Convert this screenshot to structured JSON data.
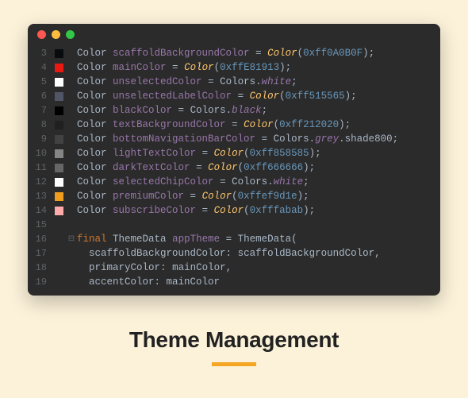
{
  "caption": "Theme Management",
  "lines": [
    {
      "num": 3,
      "swatch": "#0A0B0F",
      "t": "Color ",
      "v": "scaffoldBackgroundColor",
      "rhs_type": "call",
      "call": "Color",
      "arg": "0xff0A0B0F"
    },
    {
      "num": 4,
      "swatch": "#E81913",
      "t": "Color ",
      "v": "mainColor",
      "rhs_type": "call",
      "call": "Color",
      "arg": "0xffE81913"
    },
    {
      "num": 5,
      "swatch": "#ffffff",
      "t": "Color ",
      "v": "unselectedColor",
      "rhs_type": "prop",
      "obj": "Colors",
      "prop": "white"
    },
    {
      "num": 6,
      "swatch": "#515565",
      "t": "Color ",
      "v": "unselectedLabelColor",
      "rhs_type": "call",
      "call": "Color",
      "arg": "0xff515565"
    },
    {
      "num": 7,
      "swatch": "#000000",
      "t": "Color ",
      "v": "blackColor",
      "rhs_type": "prop",
      "obj": "Colors",
      "prop": "black"
    },
    {
      "num": 8,
      "swatch": "#212020",
      "t": "Color ",
      "v": "textBackgroundColor",
      "rhs_type": "call",
      "call": "Color",
      "arg": "0xff212020"
    },
    {
      "num": 9,
      "swatch": "#424242",
      "t": "Color ",
      "v": "bottomNavigationBarColor",
      "rhs_type": "prop2",
      "obj": "Colors",
      "prop": "grey",
      "prop2": "shade800"
    },
    {
      "num": 10,
      "swatch": "#858585",
      "t": "Color ",
      "v": "lightTextColor",
      "rhs_type": "call",
      "call": "Color",
      "arg": "0xff858585"
    },
    {
      "num": 11,
      "swatch": "#666666",
      "t": "Color ",
      "v": "darkTextColor",
      "rhs_type": "call",
      "call": "Color",
      "arg": "0xff666666"
    },
    {
      "num": 12,
      "swatch": "#ffffff",
      "t": "Color ",
      "v": "selectedChipColor",
      "rhs_type": "prop",
      "obj": "Colors",
      "prop": "white"
    },
    {
      "num": 13,
      "swatch": "#ef9d1e",
      "t": "Color ",
      "v": "premiumColor",
      "rhs_type": "call",
      "call": "Color",
      "arg": "0xffef9d1e"
    },
    {
      "num": 14,
      "swatch": "#ffabab",
      "t": "Color ",
      "v": "subscribeColor",
      "rhs_type": "call",
      "call": "Color",
      "arg": "0xfffabab"
    },
    {
      "num": 15,
      "swatch": "",
      "blank": true
    },
    {
      "num": 16,
      "swatch": "",
      "theme_open": true,
      "kw": "final",
      "cls": "ThemeData",
      "var": "appTheme",
      "ctor": "ThemeData"
    },
    {
      "num": 17,
      "swatch": "",
      "named": "scaffoldBackgroundColor",
      "val": "scaffoldBackgroundColor"
    },
    {
      "num": 18,
      "swatch": "",
      "named": "primaryColor",
      "val": "mainColor"
    },
    {
      "num": 19,
      "swatch": "",
      "named": "accentColor",
      "val": "mainColor",
      "cut": true
    }
  ]
}
